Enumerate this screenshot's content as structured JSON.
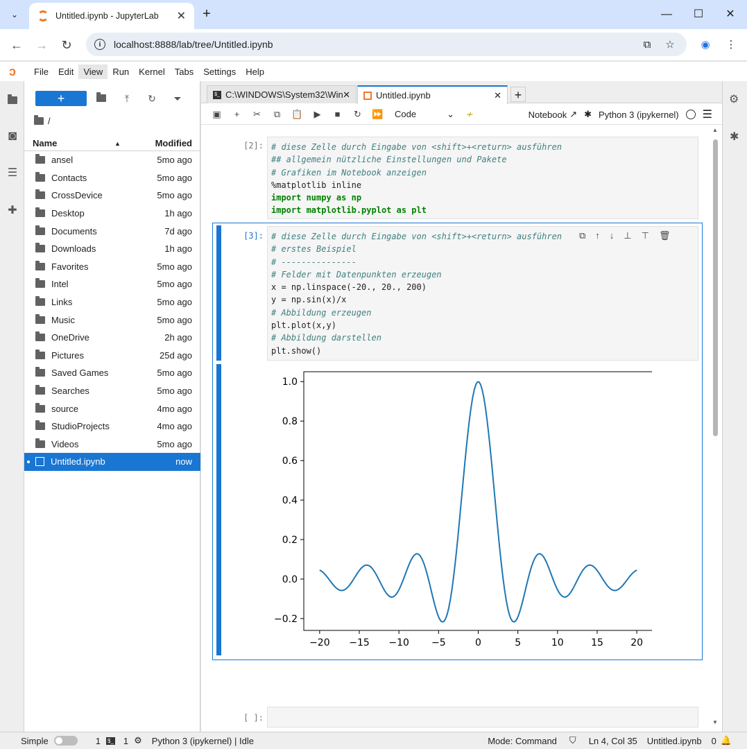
{
  "browser": {
    "tab_title": "Untitled.ipynb - JupyterLab",
    "url": "localhost:8888/lab/tree/Untitled.ipynb"
  },
  "menu": [
    "File",
    "Edit",
    "View",
    "Run",
    "Kernel",
    "Tabs",
    "Settings",
    "Help"
  ],
  "filebrowser": {
    "new_label": "+",
    "crumb": "/",
    "col_name": "Name",
    "col_modified": "Modified",
    "items": [
      {
        "name": "ansel",
        "modified": "5mo ago"
      },
      {
        "name": "Contacts",
        "modified": "5mo ago"
      },
      {
        "name": "CrossDevice",
        "modified": "5mo ago"
      },
      {
        "name": "Desktop",
        "modified": "1h ago"
      },
      {
        "name": "Documents",
        "modified": "7d ago"
      },
      {
        "name": "Downloads",
        "modified": "1h ago"
      },
      {
        "name": "Favorites",
        "modified": "5mo ago"
      },
      {
        "name": "Intel",
        "modified": "5mo ago"
      },
      {
        "name": "Links",
        "modified": "5mo ago"
      },
      {
        "name": "Music",
        "modified": "5mo ago"
      },
      {
        "name": "OneDrive",
        "modified": "2h ago"
      },
      {
        "name": "Pictures",
        "modified": "25d ago"
      },
      {
        "name": "Saved Games",
        "modified": "5mo ago"
      },
      {
        "name": "Searches",
        "modified": "5mo ago"
      },
      {
        "name": "source",
        "modified": "4mo ago"
      },
      {
        "name": "StudioProjects",
        "modified": "4mo ago"
      },
      {
        "name": "Videos",
        "modified": "5mo ago"
      }
    ],
    "selected": {
      "name": "Untitled.ipynb",
      "modified": "now"
    }
  },
  "doc_tabs": {
    "terminal": "C:\\WINDOWS\\System32\\Win",
    "notebook": "Untitled.ipynb"
  },
  "toolbar": {
    "cell_type": "Code",
    "notebook_label": "Notebook",
    "kernel": "Python 3 (ipykernel)"
  },
  "cells": {
    "c2_prompt": "[2]:",
    "c3_prompt": "[3]:",
    "empty_prompt": "[ ]:",
    "c2_lines": [
      "# diese Zelle durch Eingabe von <shift>+<return> ausführen",
      "## allgemein nützliche Einstellungen und Pakete",
      "# Grafiken im Notebook anzeigen",
      "%matplotlib inline",
      "import numpy as np",
      "import matplotlib.pyplot as plt"
    ],
    "c3_lines": [
      "# diese Zelle durch Eingabe von <shift>+<return> ausführen",
      "# erstes Beispiel",
      "# ---------------",
      "# Felder mit Datenpunkten erzeugen",
      "x = np.linspace(-20., 20., 200)",
      "y = np.sin(x)/x",
      "# Abbildung erzeugen",
      "plt.plot(x,y)",
      "# Abbildung darstellen",
      "plt.show()"
    ]
  },
  "chart_data": {
    "type": "line",
    "series": [
      {
        "color": "#1f77b4",
        "function": "sin(x)/x",
        "x_range": [
          -20,
          20
        ],
        "n_points": 200
      }
    ],
    "xlim": [
      -22,
      22
    ],
    "ylim": [
      -0.26,
      1.05
    ],
    "xticks": [
      "−20",
      "−15",
      "−10",
      "−5",
      "0",
      "5",
      "10",
      "15",
      "20"
    ],
    "yticks": [
      "−0.2",
      "0.0",
      "0.2",
      "0.4",
      "0.6",
      "0.8",
      "1.0"
    ],
    "grid": false
  },
  "statusbar": {
    "mode_label": "Simple",
    "terminals": "1",
    "kernels": "1",
    "kernel_status": "Python 3 (ipykernel) | Idle",
    "mode": "Mode: Command",
    "position": "Ln 4, Col 35",
    "filename": "Untitled.ipynb",
    "notifications": "0"
  }
}
